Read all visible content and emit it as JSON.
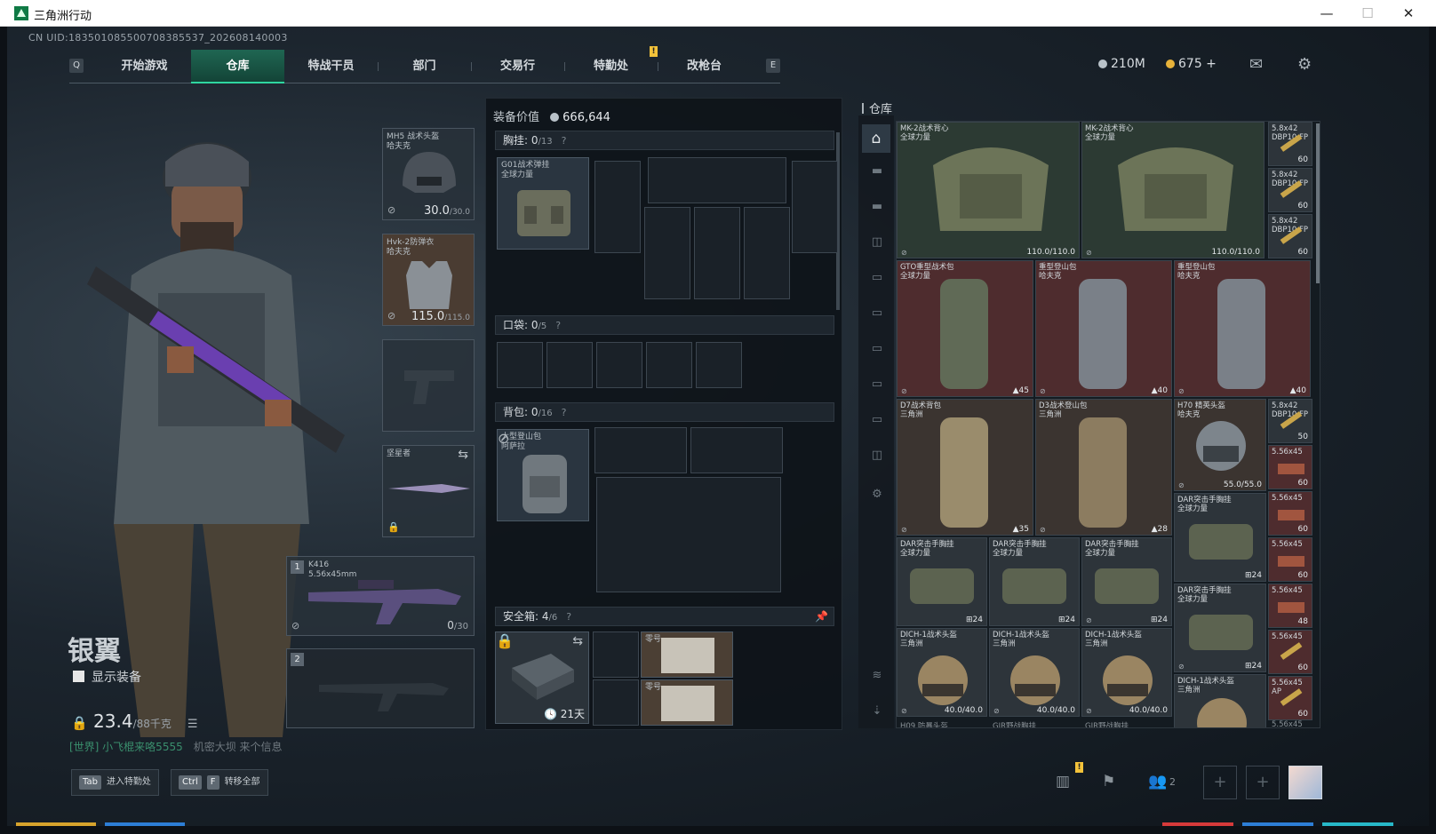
{
  "window": {
    "title": "三角洲行动",
    "min": "—",
    "max": "☐",
    "close": "✕"
  },
  "uid": "CN UID:18350108550070838553​7_202608140003",
  "nav": {
    "left_key": "Q",
    "right_key": "E",
    "tabs": [
      "开始游戏",
      "仓库",
      "特战干员",
      "部门",
      "交易行",
      "特勤处",
      "改枪台"
    ],
    "active": "仓库",
    "notif": "!"
  },
  "currency": {
    "silver": "210M",
    "gold": "675 +"
  },
  "operator": {
    "name": "银翼",
    "show_equip_label": "显示装备",
    "weight": "23.4",
    "weight_max": "/88千克",
    "chat_channel": "[世界] 小飞棍来咯5555",
    "chat_text": "机密大坝 来个信息"
  },
  "slots": {
    "helmet": {
      "label": "MH5 战术头盔\n哈夫克",
      "dur": "30.0",
      "max": "/30.0"
    },
    "armor": {
      "label": "Hvk-2防弹衣\n哈夫克",
      "dur": "115.0",
      "max": "/115.0"
    },
    "melee": {
      "label": "坚星者"
    },
    "primary": {
      "num": "1",
      "label": "K416\n5.56x45mm",
      "ammo": "0",
      "ammo_max": "/30"
    },
    "secondary": {
      "num": "2"
    }
  },
  "loadout": {
    "value_label": "装备价值",
    "value": "666,644",
    "chest": {
      "title": "胸挂:",
      "count": "0",
      "cap": "/13",
      "item": "G01战术弹挂\n全球力量"
    },
    "pocket": {
      "title": "口袋:",
      "count": "0",
      "cap": "/5"
    },
    "backpack": {
      "title": "背包:",
      "count": "0",
      "cap": "/16",
      "item": "大型登山包\n阿萨拉"
    },
    "safebox": {
      "title": "安全箱:",
      "count": "4",
      "cap": "/6",
      "timer": "21天",
      "item1": "零号",
      "item2": "零号"
    },
    "help": "?"
  },
  "warehouse": {
    "title": "仓库",
    "items": [
      {
        "name": "MK-2战术背心\n全球力量",
        "br": "110.0/110.0",
        "cls": "green"
      },
      {
        "name": "MK-2战术背心\n全球力量",
        "br": "110.0/110.0",
        "cls": "green"
      },
      {
        "name": "GTO重型战术包\n全球力量",
        "br": "45",
        "cls": "red"
      },
      {
        "name": "重型登山包\n哈夫克",
        "br": "40",
        "cls": "red"
      },
      {
        "name": "重型登山包\n哈夫克",
        "br": "40",
        "cls": "red"
      },
      {
        "name": "D7战术背包\n三角洲",
        "br": "35",
        "cls": "tan"
      },
      {
        "name": "D3战术登山包\n三角洲",
        "br": "28",
        "cls": "tan"
      },
      {
        "name": "H70 精英头盔\n哈夫克",
        "br": "55.0/55.0",
        "cls": "tan"
      },
      {
        "name": "DAR突击手胸挂\n全球力量",
        "br": "24",
        "cls": "grey"
      },
      {
        "name": "DAR突击手胸挂\n全球力量",
        "br": "24",
        "cls": "grey"
      },
      {
        "name": "DAR突击手胸挂\n全球力量",
        "br": "24",
        "cls": "grey"
      },
      {
        "name": "DAR突击手胸挂\n全球力量",
        "br": "24",
        "cls": "grey"
      },
      {
        "name": "DAR突击手胸挂\n全球力量",
        "br": "24",
        "cls": "grey"
      },
      {
        "name": "DICH-1战术头盔\n三角洲",
        "br": "40.0/40.0",
        "cls": "grey"
      },
      {
        "name": "DICH-1战术头盔\n三角洲",
        "br": "40.0/40.0",
        "cls": "grey"
      },
      {
        "name": "DICH-1战术头盔\n三角洲",
        "br": "40.0/40.0",
        "cls": "grey"
      },
      {
        "name": "DICH-1战术头盔\n三角洲",
        "br": "",
        "cls": "grey"
      },
      {
        "name": "5.8x42\nDBP10 FP",
        "br": "60",
        "cls": "grey"
      },
      {
        "name": "5.8x42\nDBP10 FP",
        "br": "60",
        "cls": "grey"
      },
      {
        "name": "5.8x42\nDBP10 FP",
        "br": "60",
        "cls": "grey"
      },
      {
        "name": "5.8x42\nDBP10 FP",
        "br": "50",
        "cls": "grey"
      },
      {
        "name": "5.56x45",
        "br": "60",
        "cls": "red"
      },
      {
        "name": "5.56x45",
        "br": "60",
        "cls": "red"
      },
      {
        "name": "5.56x45",
        "br": "60",
        "cls": "red"
      },
      {
        "name": "5.56x45",
        "br": "48",
        "cls": "red"
      },
      {
        "name": "5.56x45",
        "br": "60",
        "cls": "red"
      },
      {
        "name": "5.56x45\nAP",
        "br": "60",
        "cls": "red"
      }
    ],
    "bottom_labels": [
      "H09 防暴头盔",
      "GIR野战胸挂",
      "GIR野战胸挂",
      "5.56x45"
    ]
  },
  "bottom": {
    "tab_key": "Tab",
    "tab_label": "进入特勤处",
    "ctrl_key": "Ctrl",
    "f_key": "F",
    "transfer_label": "转移全部",
    "squad_count": "2",
    "plus": "+"
  },
  "colors": {
    "accent": "#2fd6a0",
    "gold": "#f3c23a"
  }
}
